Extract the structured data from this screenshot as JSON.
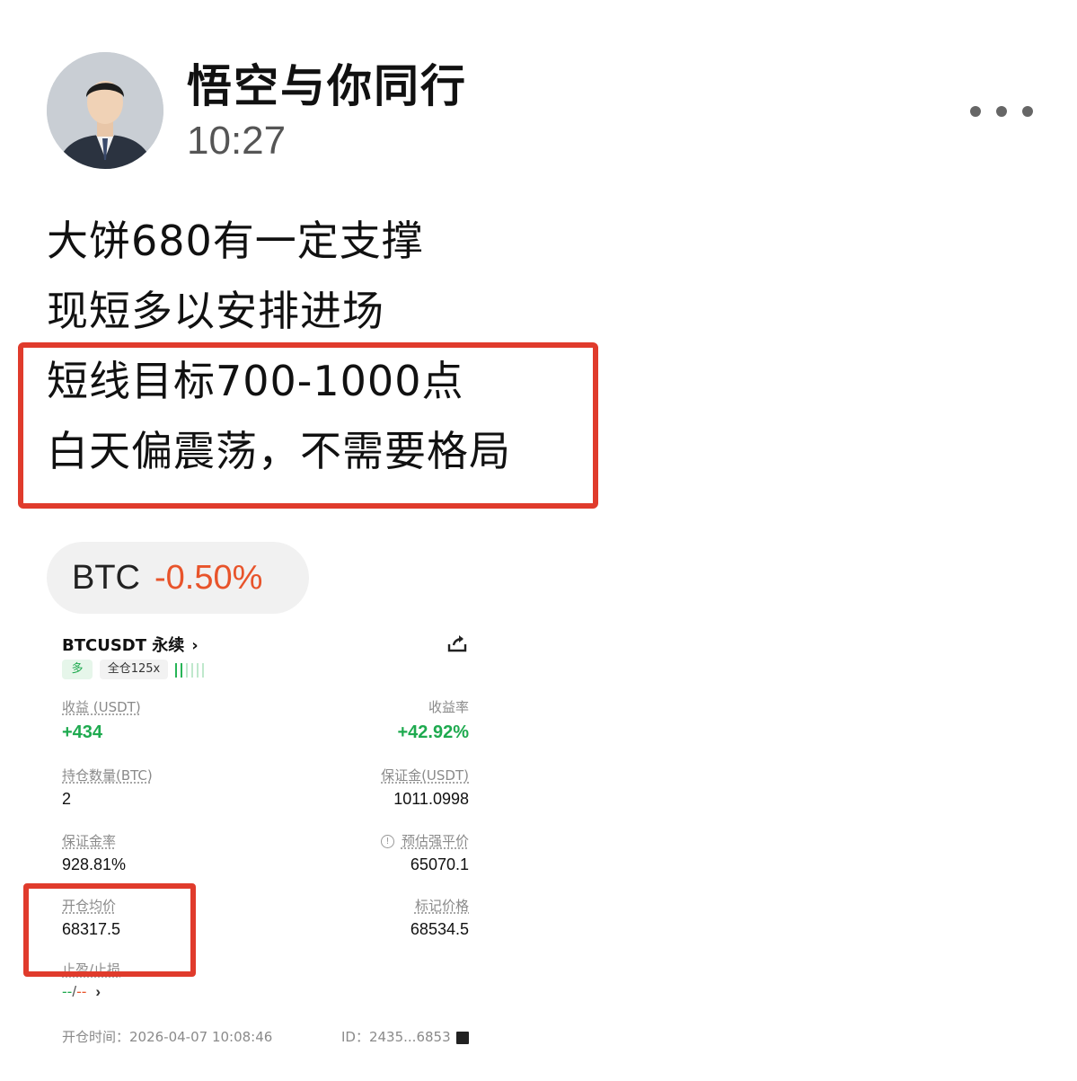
{
  "header": {
    "author_name": "悟空与你同行",
    "time": "10:27"
  },
  "post": {
    "lines": [
      "大饼680有一定支撑",
      "现短多以安排进场",
      "短线目标700-1000点",
      "白天偏震荡，不需要格局"
    ]
  },
  "ticker": {
    "symbol": "BTC",
    "change": "-0.50%"
  },
  "position_card": {
    "title": "BTCUSDT 永续",
    "side_tag": "多",
    "leverage_tag": "全仓125x",
    "pnl_label": "收益 (USDT)",
    "pnl_value": "+434",
    "roe_label": "收益率",
    "roe_value": "+42.92%",
    "qty_label": "持仓数量(BTC)",
    "qty_value": "2",
    "margin_label": "保证金(USDT)",
    "margin_value": "1011.0998",
    "margin_ratio_label": "保证金率",
    "margin_ratio_value": "928.81%",
    "liq_label": "预估强平价",
    "liq_value": "65070.1",
    "entry_label": "开仓均价",
    "entry_value": "68317.5",
    "mark_label": "标记价格",
    "mark_value": "68534.5",
    "tpsl_label": "止盈/止损",
    "tpsl_tp": "--",
    "tpsl_sep": "/",
    "tpsl_sl": "--",
    "open_time": "开仓时间：2026-04-07 10:08:46",
    "id": "ID：2435...6853"
  },
  "colors": {
    "up_green": "#1eaa4f",
    "down_red": "#e8542b",
    "highlight_red": "#e03b2c"
  },
  "icons": [
    "more-icon",
    "share-icon",
    "chevron-right-icon",
    "info-icon",
    "copy-icon"
  ]
}
